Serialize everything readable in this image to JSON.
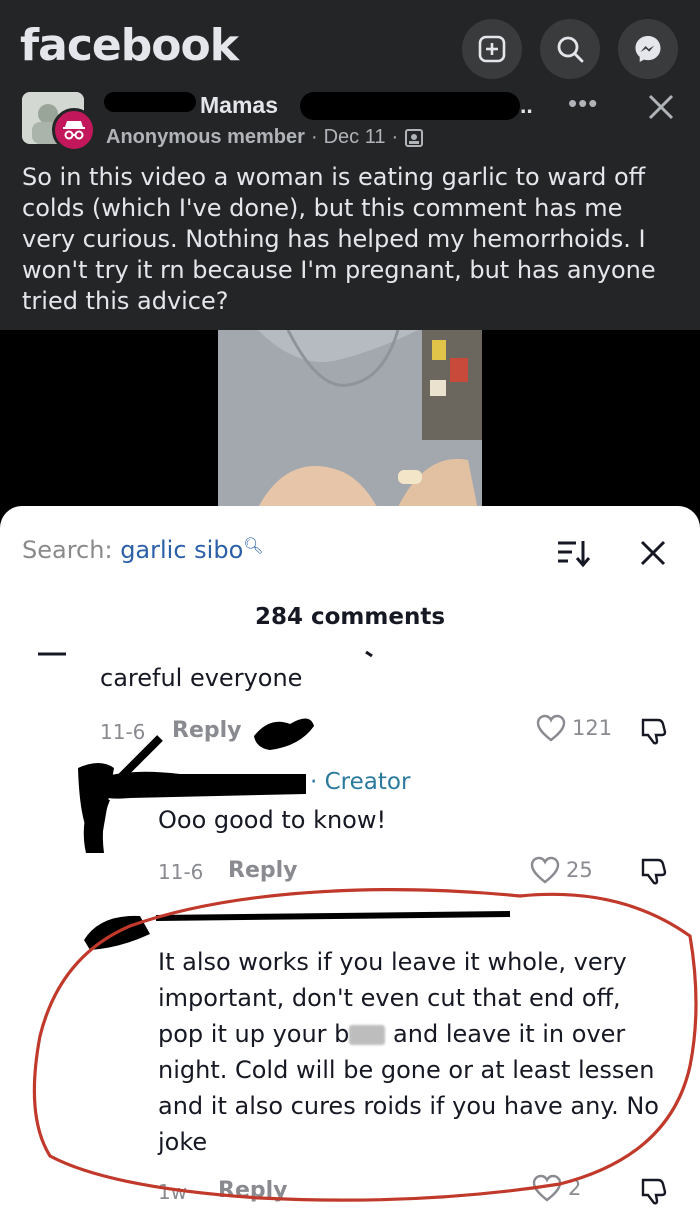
{
  "app": {
    "brand": "facebook",
    "accent": "#e4e6eb",
    "bg": "#242526"
  },
  "header_icons": [
    "plus-icon",
    "search-icon",
    "messenger-icon"
  ],
  "post": {
    "group_name": "Mamas",
    "author": "Anonymous member",
    "date": "Dec 11",
    "separator": "·",
    "more_label": "•••",
    "text": "So in this video a woman is eating garlic to ward off colds (which I've done), but this comment has me very curious. Nothing has helped my hemorrhoids. I won't try it rn because I'm pregnant, but has anyone tried this advice?"
  },
  "comments_sheet": {
    "search_label": "Search:",
    "search_query": "garlic sibo",
    "count_label": "284 comments",
    "comments": [
      {
        "text": "careful everyone",
        "date": "11-6",
        "reply": "Reply",
        "likes": "121"
      },
      {
        "creator_tag": "· Creator",
        "text": "Ooo good to know!",
        "date": "11-6",
        "reply": "Reply",
        "likes": "25"
      },
      {
        "text_lines": [
          "It also works if you leave it whole, very",
          "important, don't even cut that end off,",
          "pop it up your b",
          "and leave it in over",
          "night. Cold will be gone or at least lessen",
          "and it also cures roids if you have any. No",
          "joke"
        ],
        "date": "1w",
        "reply": "Reply",
        "likes": "2"
      }
    ],
    "annotation_color": "#c0392b"
  }
}
